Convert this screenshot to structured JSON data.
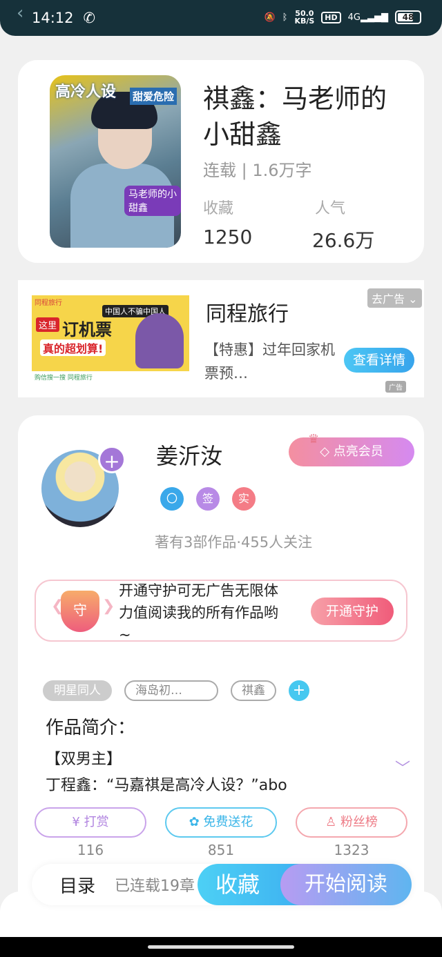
{
  "status_bar": {
    "time": "14:12",
    "net_speed_top": "50.0",
    "net_speed_bottom": "KB/S",
    "hd": "HD",
    "signal": "4G",
    "battery": "48"
  },
  "book": {
    "cover": {
      "title_left": "高冷人设",
      "title_right": "甜爱危险",
      "tag": "马老师的小甜鑫"
    },
    "title": "祺鑫：马老师的小甜鑫",
    "meta": "连载 | 1.6万字",
    "collect_label": "收藏",
    "collect_value": "1250",
    "popularity_label": "人气",
    "popularity_value": "26.6万"
  },
  "ad": {
    "image": {
      "brand": "同程旅行",
      "badge": "这里",
      "headline": "订机票",
      "sub": "真的超划算!",
      "slogan": "中国人不骗中国人",
      "strip": "购信搜一搜  同程旅行"
    },
    "title": "同程旅行",
    "desc": "【特惠】过年回家机票预…",
    "close_label": "去广告",
    "cta": "查看详情",
    "tag": "广告"
  },
  "author": {
    "name": "姜沂汝",
    "vip_button": "点亮会员",
    "badges": [
      "〇",
      "签",
      "实"
    ],
    "stats": "著有3部作品·455人关注",
    "guard": {
      "icon": "守",
      "text": "开通守护可无广告无限体力值阅读我的所有作品哟~",
      "button": "开通守护"
    },
    "tags": [
      "明星同人",
      "海岛初…",
      "祺鑫"
    ],
    "intro_heading": "作品简介：",
    "intro_lines": [
      "【双男主】",
      "丁程鑫：“马嘉祺是高冷人设？”abo"
    ],
    "actions": [
      {
        "label": "打赏",
        "icon": "¥",
        "count": "116"
      },
      {
        "label": "免费送花",
        "icon": "✿",
        "count": "851"
      },
      {
        "label": "粉丝榜",
        "icon": "♙",
        "count": "1323"
      }
    ]
  },
  "footer": {
    "menu": "目录",
    "status": "已连载19章",
    "collect": "收藏",
    "read": "开始阅读"
  }
}
